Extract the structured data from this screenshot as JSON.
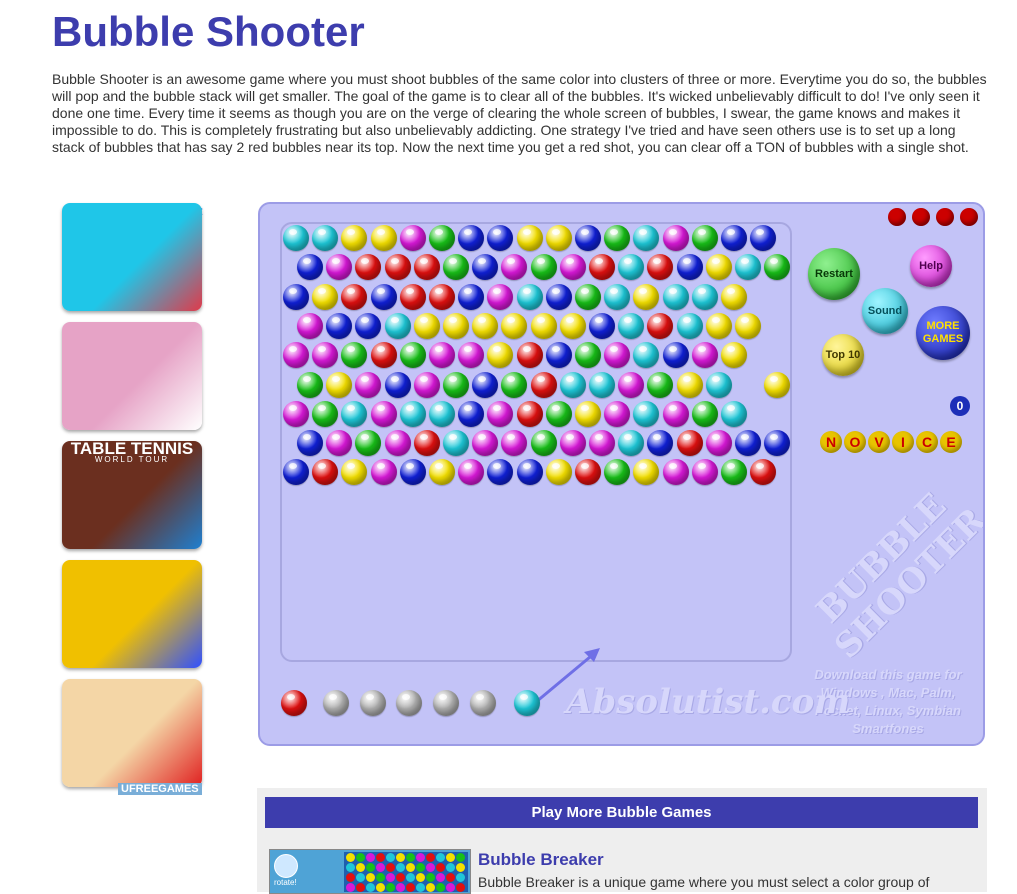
{
  "page": {
    "title": "Bubble Shooter",
    "intro": "Bubble Shooter is an awesome game where you must shoot bubbles of the same color into clusters of three or more. Everytime you do so, the bubbles will pop and the bubble stack will get smaller. The goal of the game is to clear all of the bubbles. It's wicked unbelievably difficult to do! I've only seen it done one time. Every time it seems as though you are on the verge of clearing the whole screen of bubbles, I swear, the game knows and makes it impossible to do. This is completely frustrating but also unbelievably addicting. One strategy I've tried and have seen others use is to set up a long stack of bubbles that has say 2 red bubbles near its top. Now the next time you get a red shot, you can clear off a TON of bubbles with a single shot."
  },
  "ads": {
    "badge": "ⓘ✕",
    "brand": "UFREEGAMES",
    "tiles": [
      {
        "name": "ad-tile-cube-jump",
        "colors": [
          "#1fc6e8",
          "#e03a4a"
        ]
      },
      {
        "name": "ad-tile-bathroom",
        "colors": [
          "#e6a3c6",
          "#ffffff"
        ]
      },
      {
        "name": "ad-tile-table-tennis",
        "colors": [
          "#6b2f1f",
          "#1f7fd0"
        ],
        "text": "TABLE TENNIS",
        "subtext": "WORLD TOUR"
      },
      {
        "name": "ad-tile-rubiks-cube",
        "colors": [
          "#f0c000",
          "#3050ff"
        ]
      },
      {
        "name": "ad-tile-tic-tac-toe",
        "colors": [
          "#f4d6a6",
          "#e02020"
        ]
      }
    ]
  },
  "game": {
    "window_buttons": [
      "minimize-icon",
      "maximize-icon",
      "fullscreen-icon",
      "close-icon"
    ],
    "buttons": {
      "restart": "Restart",
      "help": "Help",
      "sound": "Sound",
      "more_games": "MORE GAMES",
      "top10": "Top 10"
    },
    "score": "0",
    "level": [
      "N",
      "O",
      "V",
      "I",
      "C",
      "E"
    ],
    "watermark_title": "BUBBLE SHOOTER",
    "brand": "Absolutist.com",
    "download_note": "Download this game for Windows , Mac, Palm, Pocket, Linux, Symbian Smartfones",
    "palette": {
      "c": "#1ec8d8",
      "y": "#f4e000",
      "m": "#d818d8",
      "r": "#e01010",
      "g": "#18c018",
      "b": "#1020d8",
      "s": "#b0b0b0"
    },
    "rows": [
      "ccyymgbbyybgcmgbb",
      "bmrrrgbmgmrcrbycg",
      "byrbrrbmcbgcyccy",
      "mbbcyyyyyybcrcyy",
      "mmgrgmmyrbgmcbmy",
      "gymbmgbgrccmgyc y",
      "mgcmccbmrgymcmgc",
      "bmgmrcmmgmmcbrmbb",
      "brymbymbbyrgymmgr"
    ],
    "queue": [
      "r",
      "s",
      "s",
      "s",
      "s",
      "s",
      "c"
    ]
  },
  "more_games": {
    "header": "Play More Bubble Games",
    "title": "Bubble Breaker",
    "desc": "Bubble Breaker is a unique game where you must select a color group of",
    "thumb_label": "rotate!"
  }
}
